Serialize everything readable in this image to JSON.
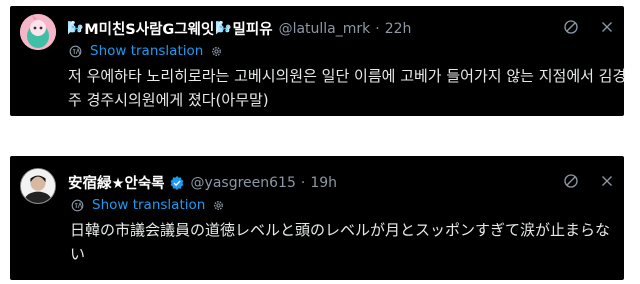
{
  "tweets": [
    {
      "display_name": "M미친S사람G그웨잇",
      "display_name_suffix": "밀피유",
      "emoji": "🌬️",
      "handle": "@latulla_mrk",
      "dot": "·",
      "time": "22h",
      "show_translation": "Show translation",
      "text": "저 우에하타 노리히로라는 고베시의원은 일단 이름에 고베가 들어가지 않는 지점에서 김경주 경주시의원에게 졌다(아무말)"
    },
    {
      "display_name": "安宿緑★안숙록",
      "handle": "@yasgreen615",
      "dot": "·",
      "time": "19h",
      "show_translation": "Show translation",
      "text": "日韓の市議会議員の道徳レベルと頭のレベルが月とスッポンすぎて涙が止まらない"
    }
  ],
  "colors": {
    "card_bg": "#000000",
    "text": "#e7e9ea",
    "muted": "#8b98a5",
    "accent": "#1d9bf0"
  }
}
